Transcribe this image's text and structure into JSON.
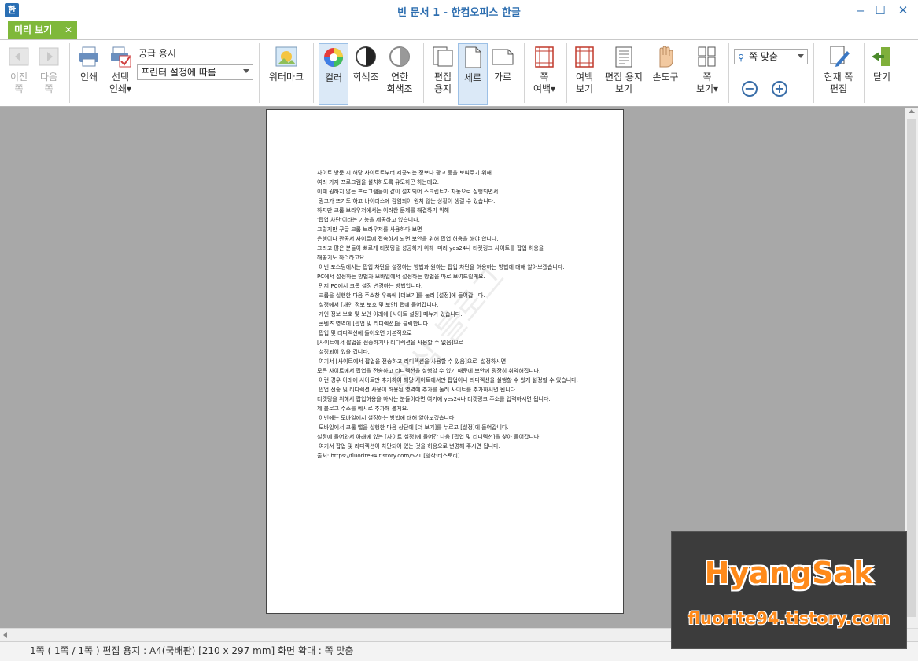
{
  "window": {
    "title": "빈 문서 1 - 한컴오피스 한글",
    "app_icon_glyph": "한",
    "minimize": "‒",
    "maximize": "☐",
    "close": "✕"
  },
  "tab": {
    "label": "미리 보기",
    "close": "✕"
  },
  "ribbon": {
    "prev_page": "이전\n쪽",
    "next_page": "다음\n쪽",
    "print": "인쇄",
    "select_print": "선택\n인쇄▾",
    "supply_label": "공급 용지",
    "supply_value": "프린터 설정에 따름",
    "watermark": "워터마크",
    "color": "컬러",
    "grayscale": "회색조",
    "light_grayscale": "연한\n회색조",
    "edit_paper": "편집\n용지",
    "portrait": "세로",
    "landscape": "가로",
    "page_margin": "쪽\n여백▾",
    "margin_view": "여백\n보기",
    "edit_paper_view": "편집 용지\n보기",
    "hand_tool": "손도구",
    "page_view": "쪽\n보기▾",
    "zoom_value": "쪽 맞춤",
    "zoom_out": "−",
    "zoom_in": "+",
    "current_page_edit": "현재 쪽\n편집",
    "close": "닫기"
  },
  "document": {
    "body": "사이트 방문 시 해당 사이트로부터 제공되는 정보나 광고 등을 보여주기 위해\n여러 가지 프로그램을 설치하도록 유도하곤 하는데요.\n이때 원하지 않는 프로그램들이 같이 설치되어 스크립트가 자동으로 실행되면서\n 광고가 뜨기도 하고 바이러스에 감염되어 원치 않는 상황이 생길 수 있습니다.\n하지만 크롬 브라우저에서는 이러한 문제를 해결하기 위해\n'팝업 차단'이라는 기능을 제공하고 있습니다.\n그렇지만 구글 크롬 브라우저를 사용하다 보면\n은행이나 관공서 사이트에 접속하게 되면 보안을 위해 팝업 허용을 해야 합니다.\n그리고 많은 분들이 빠르게 티켓팅을 성공하기 위해  미리 yes24나 티켓링크 사이트를 팝업 허용을\n해놓기도 하더라고요.\n 이번 포스팅에서는 팝업 차단을 설정하는 방법과 원하는 팝업 차단을 허용하는 방법에 대해 알아보겠습니다.\nPC에서 설정하는 방법과 모바일에서 설정하는 방법을 따로 보여드릴게요.\n 먼저 PC에서 크롬 설정 변경하는 방법입니다.\n 크롬을 실행한 다음 주소창 우측에 [더보기]를 눌러 [설정]에 들어갑니다.\n 설정에서 [개인 정보 보호 및 보안] 탭에 들어갑니다.\n 개인 정보 보호 및 보안 아래에 [사이트 설정] 메뉴가 있습니다.\n 콘텐츠 영역에 [팝업 및 리디렉션]을 클릭합니다.\n 팝업 및 리디렉션에 들어오면 기본적으로\n[사이트에서 팝업을 전송하거나 리디렉션을 사용할 수 없음]으로\n 설정되어 있을 겁니다.\n 여기서 [사이트에서 팝업을 전송하고 리디렉션을 사용할 수 있음]으로  설정하시면\n모든 사이트에서 팝업을 전송하고 리디렉션을 실행할 수 있기 때문에 보안에 굉장히 취약해집니다.\n 이런 경우 아래에 사이트만 추가하여 해당 사이트에서만 팝업이나 리디렉션을 실행할 수 있게 설정할 수 있습니다.\n 팝업 전송 및 리디렉션 사용이 허용된 영역에 추가를 눌러 사이트를 추가하시면 됩니다.\n티켓팅을 위해서 팝업허용을 하시는 분들이라면 여기에 yes24나 티켓링크 주소를 입력하시면 됩니다.\n제 블로그 주소를 예시로 추가해 볼게요.\n 이번에는 모바일에서 설정하는 방법에 대해 알아보겠습니다.\n 모바일에서 크롬 앱을 실행한 다음 상단에 [더 보기]를 누르고 [설정]에 들어갑니다.\n설정에 들어와서 아래에 있는 [사이트 설정]에 들어간 다음 [팝업 및 리디렉션]을 찾아 들어갑니다.\n 여기서 팝업 및 리디렉션이 차단되어 있는 것을 허용으로 변경해 주시면 됩니다.\n출처: https://fluorite94.tistory.com/521 [향삭:티스토리]",
    "stamp": "향삭 블로그"
  },
  "status": "1쪽 ( 1쪽 / 1쪽 ) 편집 용지 : A4(국배판)  [210 x 297 mm]  화면 확대 : 쪽 맞춤",
  "brand": {
    "title": "HyangSak",
    "url": "fluorite94.tistory.com"
  },
  "icons": {
    "prev": "arrow-left-icon",
    "next": "arrow-right-icon",
    "print": "printer-icon",
    "select_print": "printer-check-icon",
    "watermark": "image-icon",
    "color": "color-wheel-icon",
    "grayscale": "grayscale-icon",
    "light_grayscale": "light-grayscale-icon",
    "edit_paper": "pages-icon",
    "portrait": "portrait-page-icon",
    "landscape": "landscape-page-icon",
    "margin": "margin-icon",
    "hand": "hand-icon",
    "page_view": "grid-icon",
    "edit": "pencil-icon",
    "close": "exit-door-icon"
  }
}
